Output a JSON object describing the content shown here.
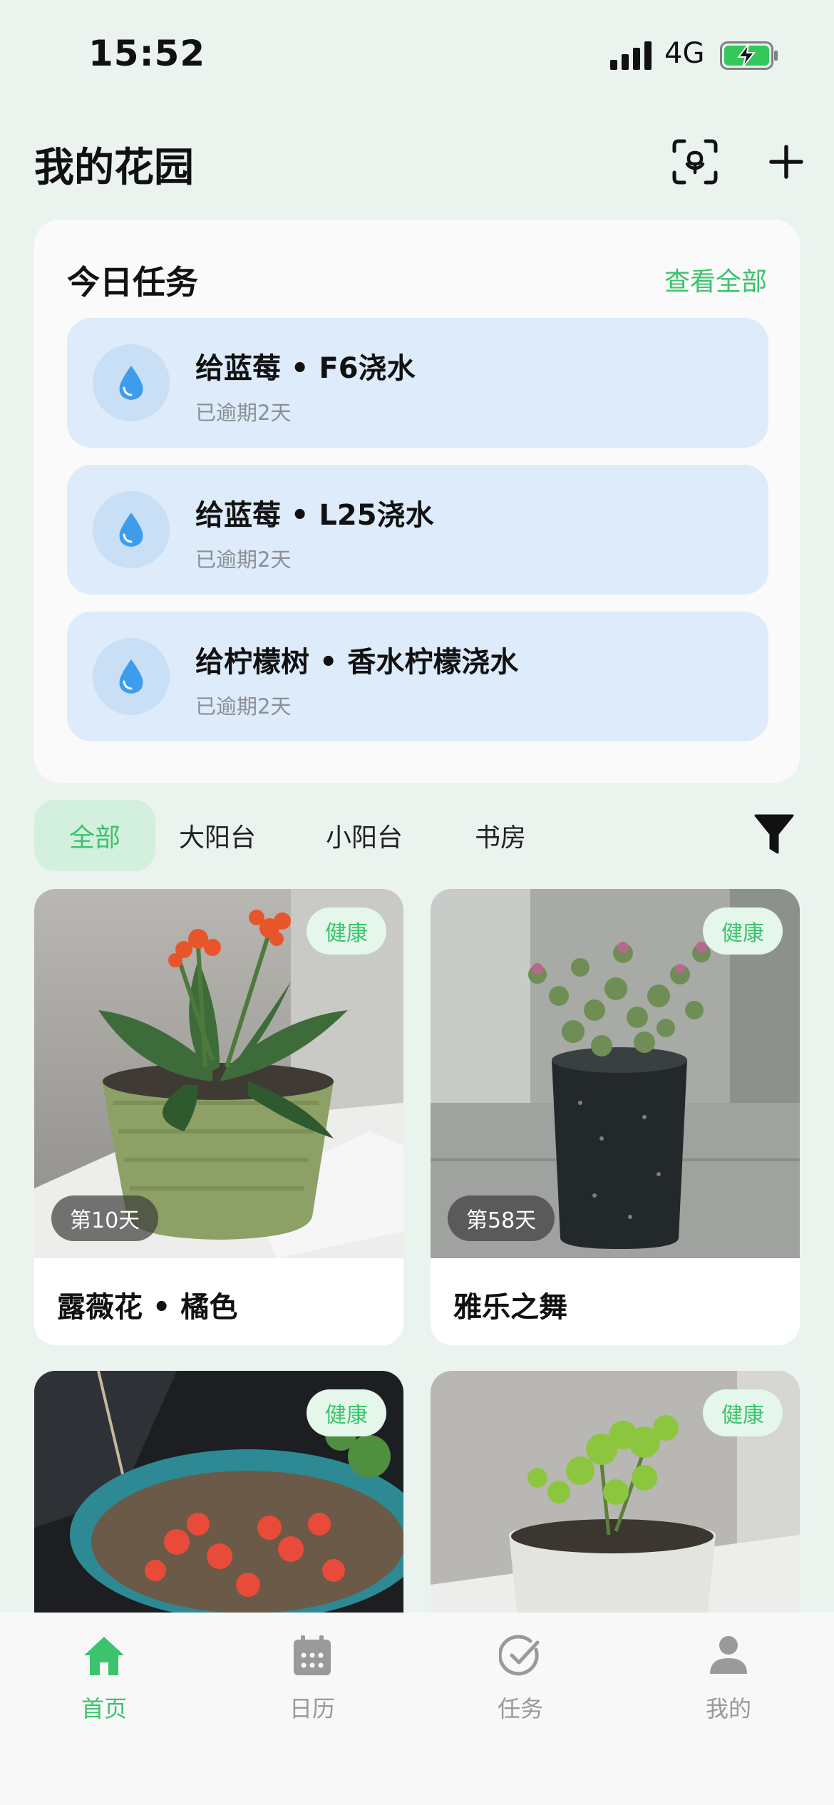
{
  "status_bar": {
    "time": "15:52",
    "network": "4G"
  },
  "header": {
    "title": "我的花园",
    "scan_icon": "plant-scan-icon",
    "add_icon": "plus-icon"
  },
  "tasks": {
    "title": "今日任务",
    "view_all": "查看全部",
    "items": [
      {
        "title": "给蓝莓 • F6浇水",
        "subtitle": "已逾期2天",
        "icon": "water-drop-icon"
      },
      {
        "title": "给蓝莓 • L25浇水",
        "subtitle": "已逾期2天",
        "icon": "water-drop-icon"
      },
      {
        "title": "给柠檬树 • 香水柠檬浇水",
        "subtitle": "已逾期2天",
        "icon": "water-drop-icon"
      }
    ]
  },
  "tabs": [
    {
      "label": "全部",
      "active": true
    },
    {
      "label": "大阳台",
      "active": false
    },
    {
      "label": "小阳台",
      "active": false
    },
    {
      "label": "书房",
      "active": false
    }
  ],
  "plants": [
    {
      "name": "露薇花 • 橘色",
      "status": "健康",
      "days": "第10天"
    },
    {
      "name": "雅乐之舞",
      "status": "健康",
      "days": "第58天"
    },
    {
      "name": "",
      "status": "健康",
      "days": ""
    },
    {
      "name": "",
      "status": "健康",
      "days": ""
    }
  ],
  "nav": [
    {
      "label": "首页",
      "icon": "home-icon",
      "active": true
    },
    {
      "label": "日历",
      "icon": "calendar-icon",
      "active": false
    },
    {
      "label": "任务",
      "icon": "check-circle-icon",
      "active": false
    },
    {
      "label": "我的",
      "icon": "person-icon",
      "active": false
    }
  ],
  "colors": {
    "accent": "#3CC36E",
    "task_bg": "#DDEBFA",
    "page_bg": "#EBF3EF",
    "water": "#3E9CEC"
  }
}
